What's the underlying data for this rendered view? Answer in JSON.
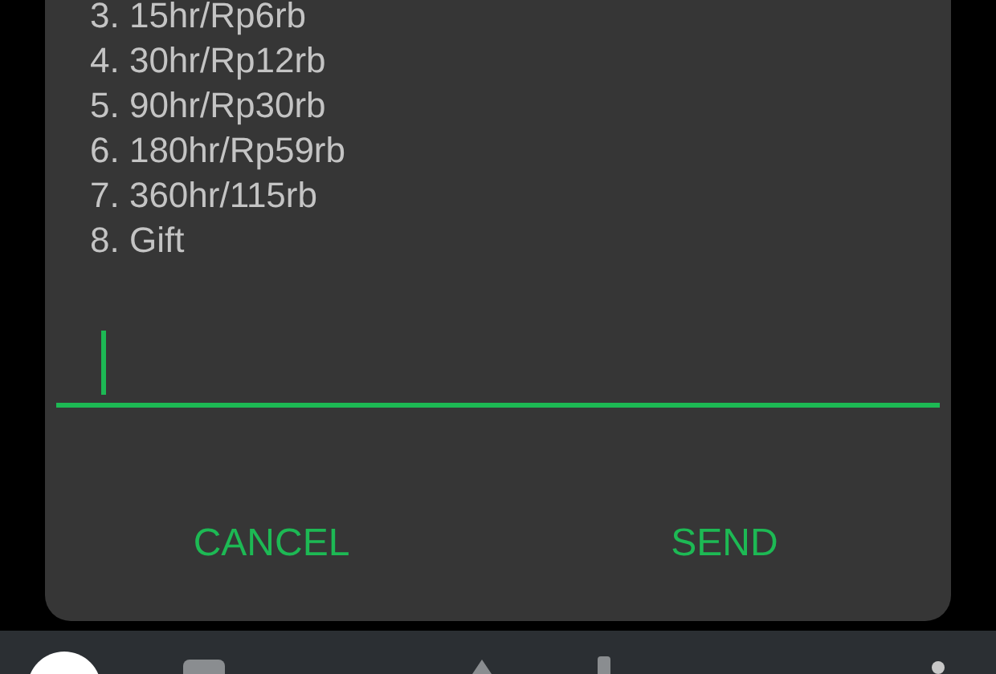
{
  "dialog": {
    "menu_items": [
      "3. 15hr/Rp6rb",
      "4. 30hr/Rp12rb",
      "5. 90hr/Rp30rb",
      "6. 180hr/Rp59rb",
      "7. 360hr/115rb",
      "8. Gift"
    ],
    "reply_field": {
      "focused": true
    },
    "buttons": [
      "CANCEL",
      "SEND"
    ]
  }
}
